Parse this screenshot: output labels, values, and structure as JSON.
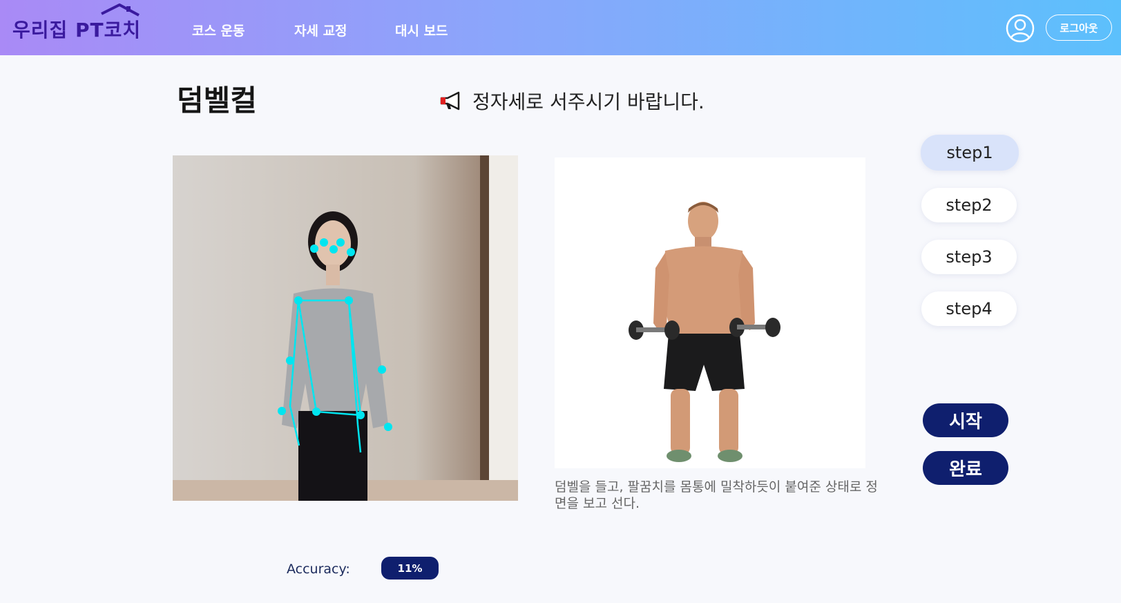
{
  "header": {
    "logo_text": "우리집 PT코치",
    "nav": [
      "코스 운동",
      "자세 교정",
      "대시 보드"
    ],
    "logout_label": "로그아웃"
  },
  "exercise": {
    "title": "덤벨컬",
    "notice": "정자세로 서주시기 바랍니다.",
    "description": "덤벨을 들고, 팔꿈치를 몸통에 밀착하듯이 붙여준 상태로 정면을 보고 선다."
  },
  "steps": [
    "step1",
    "step2",
    "step3",
    "step4"
  ],
  "active_step": "step1",
  "actions": {
    "start_label": "시작",
    "done_label": "완료"
  },
  "accuracy": {
    "label": "Accuracy:",
    "value": "11%"
  },
  "colors": {
    "brand_dark": "#0f1f6e",
    "header_gradient_start": "#a98af6",
    "header_gradient_end": "#5cc0fc",
    "pose_overlay": "#00e5f0"
  },
  "icons": [
    "house-roof-icon",
    "user-icon",
    "megaphone-icon"
  ]
}
